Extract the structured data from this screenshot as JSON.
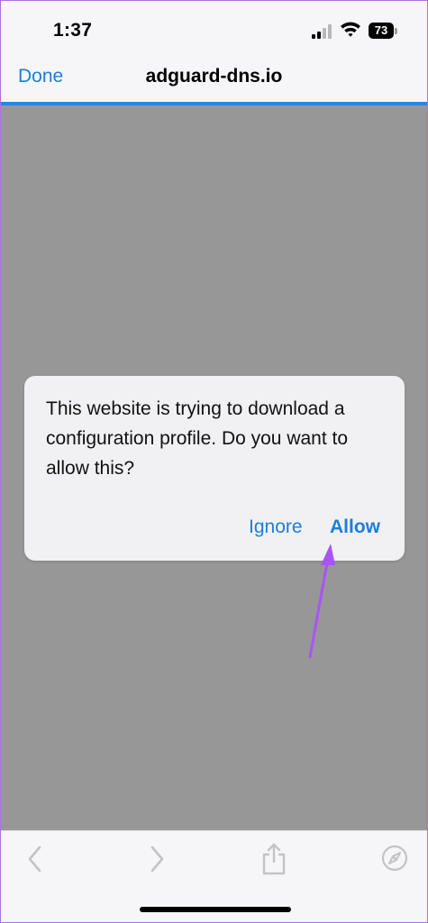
{
  "status_bar": {
    "time": "1:37",
    "battery_level": "73",
    "icons": [
      "cellular-signal-icon",
      "wifi-icon",
      "battery-icon"
    ]
  },
  "nav_bar": {
    "done_label": "Done",
    "title": "adguard-dns.io"
  },
  "alert": {
    "message": "This website is trying to download a configuration profile. Do you want to allow this?",
    "ignore_label": "Ignore",
    "allow_label": "Allow"
  },
  "annotation": {
    "type": "arrow",
    "color": "#a855f7",
    "points_to": "allow-button"
  },
  "toolbar": {
    "icons": [
      "back-chevron-icon",
      "forward-chevron-icon",
      "share-icon",
      "safari-compass-icon"
    ]
  },
  "colors": {
    "accent": "#1d7ddb",
    "progress": "#2a86e0",
    "overlay": "#979797"
  }
}
